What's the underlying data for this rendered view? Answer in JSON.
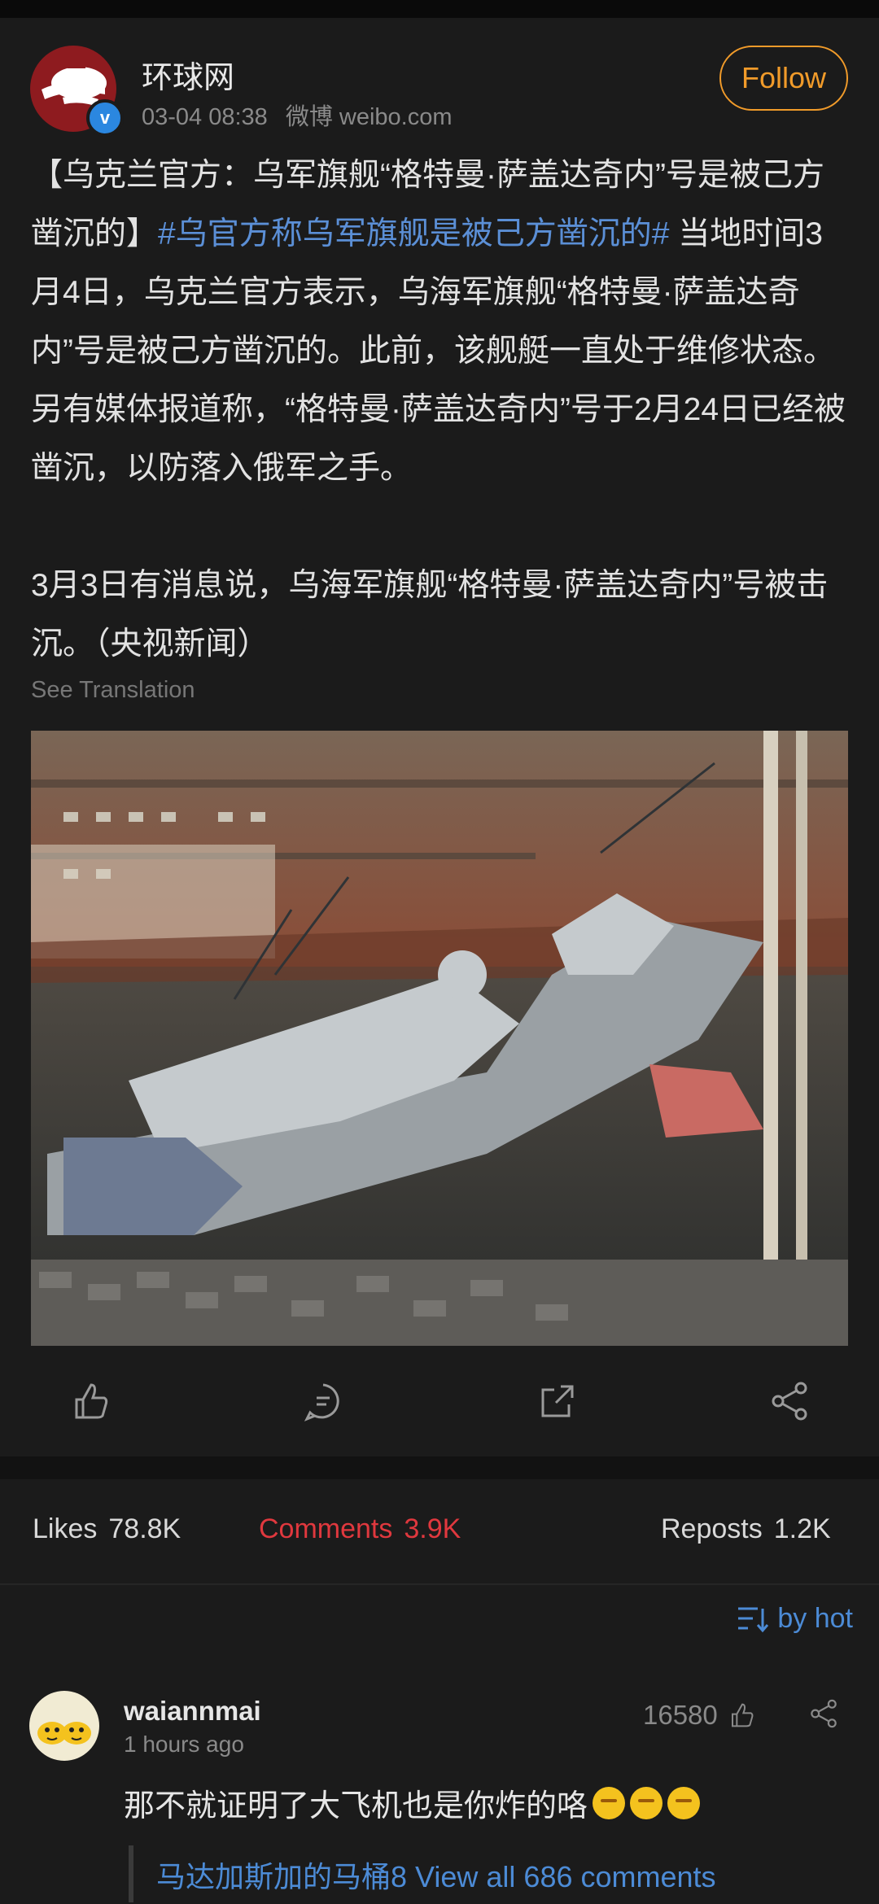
{
  "post": {
    "author": "环球网",
    "time": "03-04 08:38",
    "source": "微博 weibo.com",
    "follow_label": "Follow",
    "text_part1": "【乌克兰官方：乌军旗舰“格特曼·萨盖达奇内”号是被己方凿沉的】",
    "hashtag": "#乌官方称乌军旗舰是被己方凿沉的#",
    "text_part2": " 当地时间3月4日，乌克兰官方表示，乌海军旗舰“格特曼·萨盖达奇内”号是被己方凿沉的。此前，该舰艇一直处于维修状态。另有媒体报道称，“格特曼·萨盖达奇内”号于2月24日已经被凿沉，以防落入俄军之手。\n\n3月3日有消息说，乌海军旗舰“格特曼·萨盖达奇内”号被击沉。（央视新闻）",
    "see_translation": "See Translation"
  },
  "actions": [
    "like-icon",
    "comment-icon",
    "repost-icon",
    "share-icon"
  ],
  "stats": {
    "likes_label": "Likes",
    "likes": "78.8K",
    "comments_label": "Comments",
    "comments": "3.9K",
    "reposts_label": "Reposts",
    "reposts": "1.2K"
  },
  "comments_section": {
    "sort_label": "by hot",
    "items": [
      {
        "user": "waiannmai",
        "time": "1 hours ago",
        "likes": "16580",
        "text": "那不就证明了大飞机也是你炸的咯",
        "emoji_count": 3,
        "reply_preview": "马达加斯加的马桶8 View all 686 comments"
      }
    ]
  },
  "colors": {
    "accent_follow": "#f19b2a",
    "hashtag": "#5b8fd6",
    "active_tab": "#e0383e",
    "link": "#4c8bd6"
  }
}
